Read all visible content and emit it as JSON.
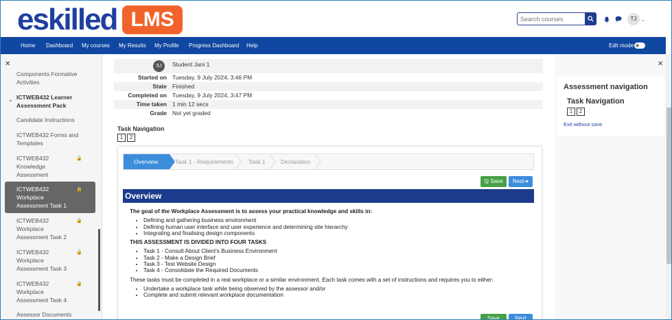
{
  "header": {
    "logo_text": "eskilled",
    "logo_badge": "LMS",
    "search_placeholder": "Search courses",
    "user_initials": "TJ"
  },
  "nav": {
    "items": [
      "Home",
      "Dashboard",
      "My courses",
      "My Results",
      "My Profile",
      "Progress Dashboard",
      "Help"
    ],
    "edit_mode_label": "Edit mode"
  },
  "drawer": {
    "items": [
      {
        "label": "Components Formative",
        "bold": false
      },
      {
        "label": "Activities",
        "bold": false
      },
      {
        "label": "ICTWEB432 Learner Assessment Pack",
        "bold": true
      },
      {
        "label": "Candidate Instructions",
        "bold": false
      },
      {
        "label": "ICTWEB432 Forms and Templates",
        "bold": false
      },
      {
        "label": "ICTWEB432 Knowledge Assessment",
        "bold": false
      },
      {
        "label": "ICTWEB432 Workplace Assessment Task 1",
        "bold": false
      },
      {
        "label": "ICTWEB432 Workplace Assessment Task 2",
        "bold": false
      },
      {
        "label": "ICTWEB432 Workplace Assessment Task 3",
        "bold": false
      },
      {
        "label": "ICTWEB432 Workplace Assessment Task 4",
        "bold": false
      },
      {
        "label": "Assessor Documents",
        "bold": false
      }
    ]
  },
  "summary": {
    "avatar_initials": "SJ",
    "student_name": "Student Jani 1",
    "rows": [
      {
        "key": "Started on",
        "value": "Tuesday, 9 July 2024, 3:46 PM"
      },
      {
        "key": "State",
        "value": "Finished"
      },
      {
        "key": "Completed on",
        "value": "Tuesday, 9 July 2024, 3:47 PM"
      },
      {
        "key": "Time taken",
        "value": "1 min 12 secs"
      },
      {
        "key": "Grade",
        "value": "Not yet graded"
      }
    ]
  },
  "task_nav": {
    "title": "Task Navigation",
    "pages": [
      "1",
      "2"
    ]
  },
  "wizard": {
    "steps": [
      "Overview",
      "Task 1 - Requirements",
      "Task 1",
      "Declaration"
    ],
    "active_step": "Overview",
    "save_label": "Save",
    "next_label": "Next"
  },
  "overview": {
    "heading": "Overview",
    "intro": "The goal of the Workplace Assessment is to assess your practical knowledge and skills in:",
    "skills": [
      "Defining and gathering business environment",
      "Defining human user interface and user experience and determining site hierarchy",
      "Integrating and finalising design components"
    ],
    "tasks_heading": "THIS ASSESSMENT IS DIVIDED INTO FOUR TASKS",
    "tasks": [
      "Task 1 - Consult About Client’s Business Environment",
      "Task 2 - Make a Design Brief",
      "Task 3 - Test  Website Design",
      "Task 4 - Consolidate the Required Documents"
    ],
    "requirement_text": "These tasks must be completed in a real workplace or a similar environment. Each task comes with a set of instructions and requires you to either:",
    "options": [
      "Undertake a workplace task while being observed by the assessor and/or",
      "Complete and submit relevant workplace documentation"
    ]
  },
  "right_drawer": {
    "title": "Assessment navigation",
    "subtitle": "Task Navigation",
    "pages": [
      "1",
      "2"
    ],
    "exit_link": "Exit without save"
  },
  "colors": {
    "nav_bg": "#0f47a1",
    "logo_blue": "#1f3fa0",
    "lms_orange": "#f0642b",
    "overview_bar": "#1c3b8c",
    "save_green": "#45a046",
    "next_blue": "#3c8ddc"
  }
}
